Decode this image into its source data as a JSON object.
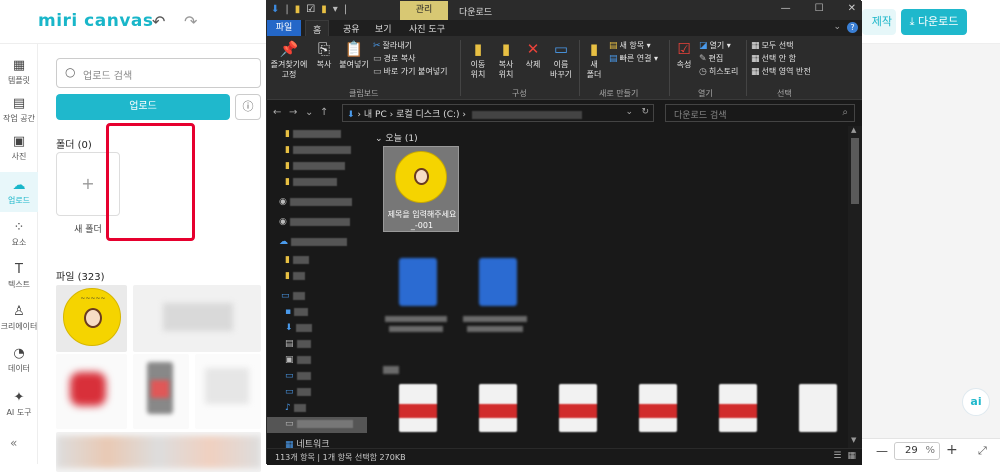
{
  "miri": {
    "logo": "miri canvas",
    "header": {
      "undo_icon": "↶",
      "redo_icon": "↷",
      "make_label": "제작",
      "download_label": "다운로드"
    },
    "rail": [
      {
        "label": "템플릿",
        "icon": "layout-icon"
      },
      {
        "label": "작업 공간",
        "icon": "workspace-icon"
      },
      {
        "label": "사진",
        "icon": "photo-icon"
      },
      {
        "label": "업로드",
        "icon": "upload-icon",
        "active": true
      },
      {
        "label": "요소",
        "icon": "elements-icon"
      },
      {
        "label": "텍스트",
        "icon": "text-icon"
      },
      {
        "label": "크리에이터",
        "icon": "creator-icon"
      },
      {
        "label": "데이터",
        "icon": "data-icon"
      },
      {
        "label": "AI 도구",
        "icon": "ai-tools-icon"
      }
    ],
    "panel": {
      "search_placeholder": "업로드 검색",
      "upload_button": "업로드",
      "folders_title": "폴더 (0)",
      "new_folder_label": "새 폴더",
      "files_title": "파일 (323)"
    },
    "ai_button": "ai",
    "zoom": {
      "value": "29",
      "unit": "%"
    }
  },
  "explorer": {
    "window_title": "다운로드",
    "context_tab": "관리",
    "ribbon_tabs": [
      "파일",
      "홈",
      "공유",
      "보기",
      "사진 도구"
    ],
    "ribbon": {
      "clipboard": {
        "group": "클립보드",
        "pin": "즐겨찾기에\n고정",
        "copy": "복사",
        "paste": "붙여넣기",
        "cut": "잘라내기",
        "copy_path": "경로 복사",
        "paste_shortcut": "바로 가기 붙여넣기"
      },
      "organize": {
        "group": "구성",
        "move": "이동\n위치",
        "copyto": "복사\n위치",
        "delete": "삭제",
        "rename": "이름\n바꾸기"
      },
      "new": {
        "group": "새로 만들기",
        "folder": "새\n폴더",
        "new_item": "새 항목",
        "easy_access": "빠른 연결"
      },
      "open": {
        "group": "열기",
        "properties": "속성",
        "open": "열기",
        "edit": "편집",
        "history": "히스토리"
      },
      "select": {
        "group": "선택",
        "all": "모두 선택",
        "none": "선택 안 함",
        "invert": "선택 영역 반전"
      }
    },
    "address": {
      "path_root": "내 PC",
      "path_drive": "로컬 디스크 (C:)",
      "search_placeholder": "다운로드 검색"
    },
    "nav_pane": {
      "network": "네트워크"
    },
    "content": {
      "group_header": "오늘 (1)",
      "selected_file": "제목을 입력해주세요_-001"
    },
    "status": {
      "text": "113개 항목  |  1개 항목 선택함 270KB"
    }
  },
  "colors": {
    "accent": "#1fb8cc",
    "highlight_outline": "#e6002e",
    "explorer_bg": "#191919"
  }
}
